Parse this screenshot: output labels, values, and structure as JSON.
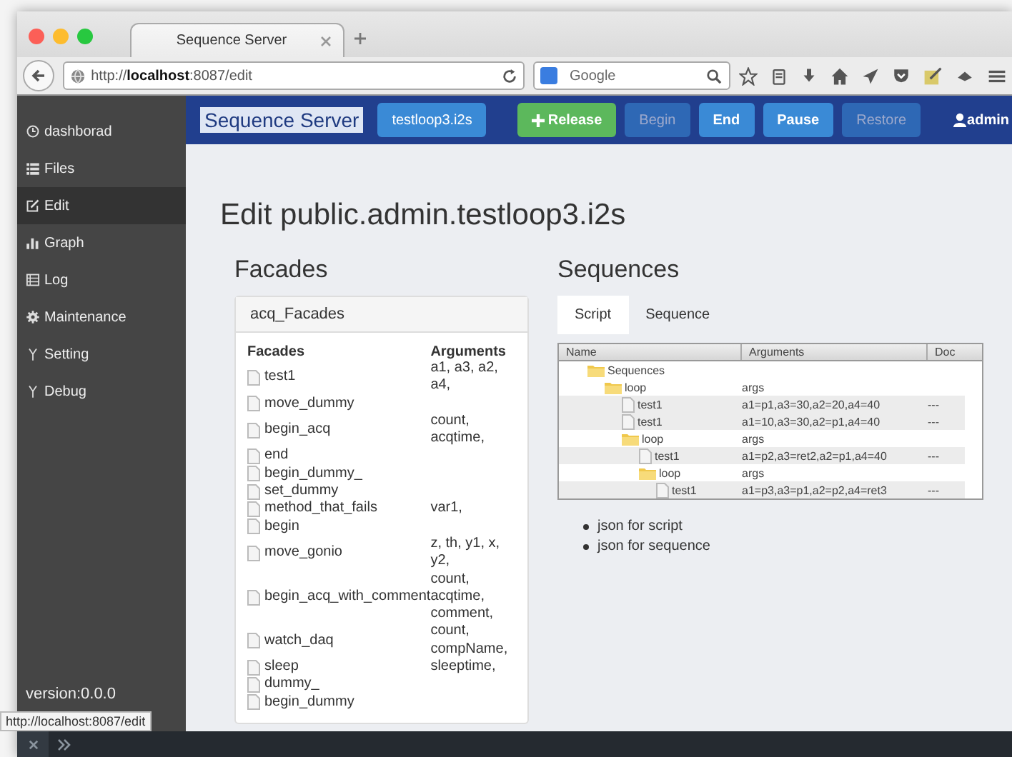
{
  "browser": {
    "tab_title": "Sequence Server",
    "url_prefix": "http://",
    "url_host": "localhost",
    "url_rest": ":8087/edit",
    "search_placeholder": "Google"
  },
  "sidebar": {
    "items": [
      {
        "label": "dashborad",
        "selected": false
      },
      {
        "label": "Files",
        "selected": false
      },
      {
        "label": "Edit",
        "selected": true
      },
      {
        "label": "Graph",
        "selected": false
      },
      {
        "label": "Log",
        "selected": false
      },
      {
        "label": "Maintenance",
        "selected": false
      },
      {
        "label": "Setting",
        "selected": false
      },
      {
        "label": "Debug",
        "selected": false
      }
    ],
    "version": "version:0.0.0"
  },
  "navbar": {
    "brand": "Sequence Server",
    "file_button": "testloop3.i2s",
    "buttons": [
      {
        "label": "Release",
        "kind": "success",
        "disabled": false
      },
      {
        "label": "Begin",
        "kind": "primary",
        "disabled": true
      },
      {
        "label": "End",
        "kind": "primary",
        "disabled": false
      },
      {
        "label": "Pause",
        "kind": "primary",
        "disabled": false
      },
      {
        "label": "Restore",
        "kind": "primary",
        "disabled": true
      }
    ],
    "user": "admin"
  },
  "page_title": "Edit public.admin.testloop3.i2s",
  "facades": {
    "heading": "Facades",
    "panel_title": "acq_Facades",
    "columns": [
      "Facades",
      "Arguments"
    ],
    "rows": [
      {
        "name": "test1",
        "args": "a1, a3, a2, a4,"
      },
      {
        "name": "move_dummy",
        "args": ""
      },
      {
        "name": "begin_acq",
        "args": "count, acqtime,"
      },
      {
        "name": "end",
        "args": ""
      },
      {
        "name": "begin_dummy_",
        "args": ""
      },
      {
        "name": "set_dummy",
        "args": ""
      },
      {
        "name": "method_that_fails",
        "args": "var1,"
      },
      {
        "name": "begin",
        "args": ""
      },
      {
        "name": "move_gonio",
        "args": "z, th, y1, x, y2,"
      },
      {
        "name": "begin_acq_with_comment",
        "args": "count, acqtime, comment,"
      },
      {
        "name": "watch_daq",
        "args": "count, compName,"
      },
      {
        "name": "sleep",
        "args": "sleeptime,"
      },
      {
        "name": "dummy_",
        "args": ""
      },
      {
        "name": "begin_dummy",
        "args": ""
      }
    ]
  },
  "sequences": {
    "heading": "Sequences",
    "tabs": [
      {
        "label": "Script",
        "selected": true
      },
      {
        "label": "Sequence",
        "selected": false
      }
    ],
    "columns": [
      "Name",
      "Arguments",
      "Doc"
    ],
    "tree": [
      {
        "name": "Sequences",
        "kind": "folder",
        "children": [
          {
            "name": "loop",
            "kind": "folder",
            "args": "args",
            "children": [
              {
                "name": "test1",
                "kind": "file",
                "args": "a1=p1,a3=30,a2=20,a4=40",
                "doc": "---"
              },
              {
                "name": "test1",
                "kind": "file",
                "args": "a1=10,a3=30,a2=p1,a4=40",
                "doc": "---"
              },
              {
                "name": "loop",
                "kind": "folder",
                "args": "args",
                "children": [
                  {
                    "name": "test1",
                    "kind": "file",
                    "args": "a1=p2,a3=ret2,a2=p1,a4=40",
                    "doc": "---"
                  },
                  {
                    "name": "loop",
                    "kind": "folder",
                    "args": "args",
                    "children": [
                      {
                        "name": "test1",
                        "kind": "file",
                        "args": "a1=p3,a3=p1,a2=p2,a4=ret3",
                        "doc": "---"
                      }
                    ]
                  }
                ]
              }
            ]
          }
        ]
      }
    ],
    "links": [
      "json for script",
      "json for sequence"
    ]
  },
  "status_url": "http://localhost:8087/edit"
}
